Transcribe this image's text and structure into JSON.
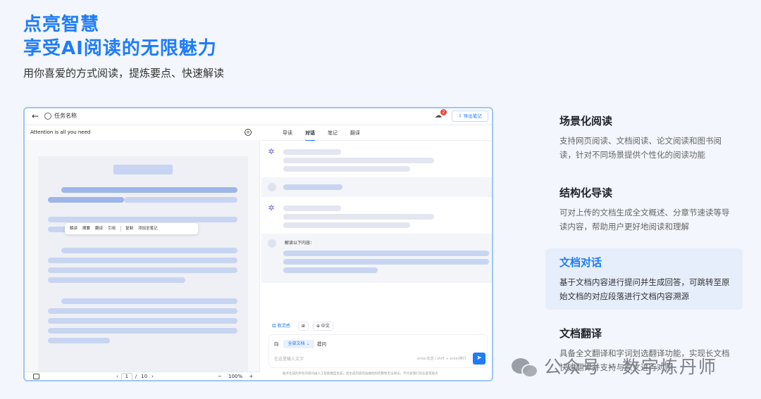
{
  "hero": {
    "title_line1": "点亮智慧",
    "title_line2": "享受AI阅读的无限魅力",
    "subtitle": "用你喜爱的方式阅读，提炼要点、快速解读"
  },
  "app": {
    "back_icon": "arrow-left-icon",
    "task_name": "任务名称",
    "notification_count": "2",
    "export_label": "导出笔记",
    "document": {
      "title": "Attention is all you need"
    },
    "selection_toolbar": {
      "items": [
        "解读",
        "摘要",
        "翻译",
        "引用",
        "复制",
        "添加至笔记"
      ]
    },
    "pager": {
      "prev": "‹",
      "current_page": "1",
      "separator": "/",
      "total_pages": "10",
      "next": "›",
      "zoom_out": "−",
      "zoom_level": "100%",
      "zoom_in": "+"
    },
    "tabs": [
      "导读",
      "对话",
      "笔记",
      "翻译"
    ],
    "active_tab": "对话",
    "chat": {
      "quote_prompt": "解读以下内容："
    },
    "chips": [
      "绘 默灵感",
      "⊞",
      "⊕ 中文"
    ],
    "input": {
      "ask_prefix": "向",
      "scope": "全部文档 ⌄",
      "ask_suffix": "提问",
      "placeholder": "在这里输入文字",
      "hint": "enter发送 / shift + enter换行",
      "send_icon": "send-icon"
    },
    "disclaimer": "服务生成的所有内容均由人工智能模型生成，其生成内容的准确性和完整性无法保证，不代表我们的态度或观点"
  },
  "features": [
    {
      "title": "场景化阅读",
      "desc": "支持网页阅读、文档阅读、论文阅读和图书阅读，针对不同场景提供个性化的阅读功能"
    },
    {
      "title": "结构化导读",
      "desc": "可对上传的文档生成全文概述、分章节速读等导读内容，帮助用户更好地阅读和理解"
    },
    {
      "title": "文档对话",
      "desc": "基于文档内容进行提问并生成回答，可跳转至原始文档的对应段落进行文档内容溯源"
    },
    {
      "title": "文档翻译",
      "desc": "具备全文翻译和字词划选翻译功能，实现长文档快速翻译并支持与原文进行对照"
    }
  ],
  "watermark": {
    "icon": "wechat-icon",
    "text": "公众号 · 数字炼丹师"
  },
  "colors": {
    "accent": "#1f7cf7",
    "active_bg": "#e6eefb"
  }
}
